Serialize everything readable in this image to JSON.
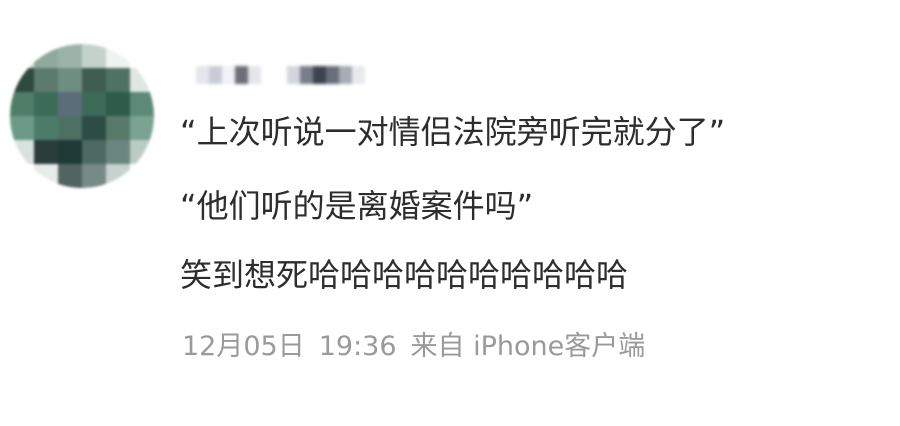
{
  "comment": {
    "avatar_icon": "pixelated-avatar",
    "username_mosaic": "pixelated-username",
    "lines": [
      "“上次听说一对情侣法院旁听完就分了”",
      "“他们听的是离婚案件吗”",
      "笑到想死哈哈哈哈哈哈哈哈哈哈"
    ],
    "meta": {
      "date": "12月05日",
      "time": "19:36",
      "source": "来自 iPhone客户端"
    }
  }
}
